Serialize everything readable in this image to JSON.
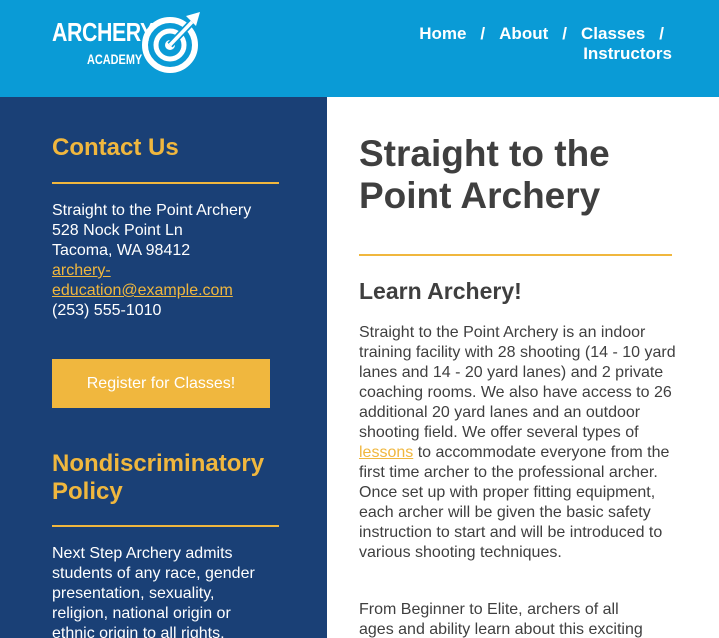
{
  "header": {
    "logo": {
      "line1": "ARCHERY",
      "line2": "ACADEMY",
      "icon": "target-arrow-icon"
    },
    "nav": {
      "items": [
        "Home",
        "About",
        "Classes",
        "Instructors"
      ],
      "separator": "/"
    }
  },
  "sidebar": {
    "contact_heading": "Contact Us",
    "address": {
      "name": "Straight to the Point Archery",
      "street": "528 Nock Point Ln",
      "city": "Tacoma, WA 98412",
      "email_line1": "archery-",
      "email_line2": "education@example.com",
      "phone": "(253) 555-1010"
    },
    "register_label": "Register for Classes!",
    "policy_heading_line1": "Nondiscriminatory",
    "policy_heading_line2": "Policy",
    "policy_lines": [
      "Next Step Archery admits",
      "students of any race, gender",
      "presentation, sexuality,",
      "religion, national origin or",
      "ethnic origin to all rights,"
    ]
  },
  "main": {
    "title_line1": "Straight to the",
    "title_line2": "Point Archery",
    "subtitle": "Learn Archery!",
    "para1": {
      "before": "Straight to the Point Archery is an indoor training facility with 28 shooting (14 - 10 yard lanes and 14 - 20 yard lanes) and 2 private coaching rooms. We also have access to 26 additional 20 yard lanes and an outdoor shooting field. We offer several types of ",
      "link": "lessons",
      "after": " to accommodate everyone from the first time archer to the professional archer. Once set up with proper fitting equipment, each archer will be given the basic safety instruction to start and will be introduced to various shooting techniques."
    },
    "para2_lines": [
      "From Beginner to Elite, archers of all",
      "ages and ability learn about this exciting"
    ]
  },
  "colors": {
    "header_bg": "#0a9bd6",
    "sidebar_bg": "#1a4076",
    "accent": "#f0b73e",
    "body_text": "#3f3f3f"
  }
}
